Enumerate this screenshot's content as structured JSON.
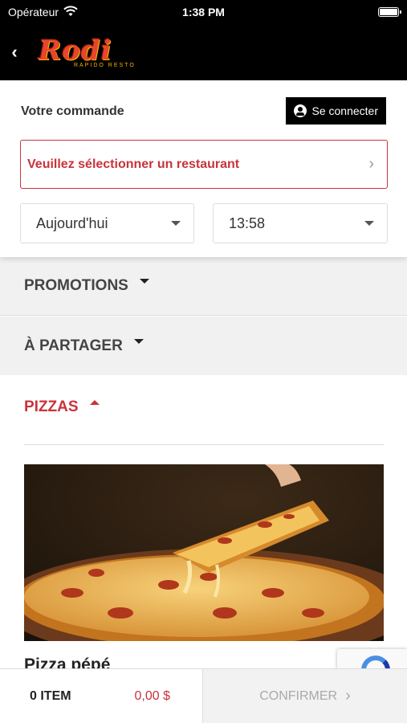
{
  "status_bar": {
    "carrier": "Opérateur",
    "time": "1:38 PM"
  },
  "header": {
    "logo_text": "Rodi",
    "logo_subtext": "Rapido Resto"
  },
  "order": {
    "title": "Votre commande",
    "connect_label": "Se connecter",
    "restaurant_prompt": "Veuillez sélectionner un restaurant",
    "day_value": "Aujourd'hui",
    "time_value": "13:58"
  },
  "categories": {
    "promotions": "PROMOTIONS",
    "partager": "À PARTAGER",
    "pizzas": "PIZZAS"
  },
  "product": {
    "name": "Pizza pépé"
  },
  "cart": {
    "item_count": "0 ITEM",
    "total": "0,00 $",
    "confirm_label": "CONFIRMER"
  },
  "colors": {
    "brand_red": "#c9333b",
    "header_bg": "#000000",
    "category_bg": "#f1f1f1"
  }
}
